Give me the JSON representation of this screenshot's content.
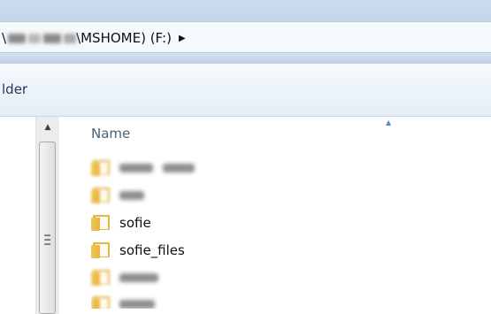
{
  "address_bar": {
    "path_suffix": "\\MSHOME) (F:)"
  },
  "toolbar": {
    "button_label": "lder"
  },
  "list": {
    "column_name": "Name",
    "rows": [
      {
        "name": "",
        "blurred": true
      },
      {
        "name": "",
        "blurred": true
      },
      {
        "name": "sofie",
        "blurred": false
      },
      {
        "name": "sofie_files",
        "blurred": false
      },
      {
        "name": "",
        "blurred": true
      },
      {
        "name": "",
        "blurred": true
      }
    ]
  },
  "icons": {
    "breadcrumb_arrow": "chevron-right-icon",
    "folder": "folder-icon",
    "scroll_up": "arrow-up-icon",
    "sort": "sort-ascending-icon"
  },
  "colors": {
    "folder": "#e3b64a",
    "address_bar_bg": "#f6f9fc",
    "toolbar_text": "#1e3957",
    "header_text": "#4c607a"
  }
}
